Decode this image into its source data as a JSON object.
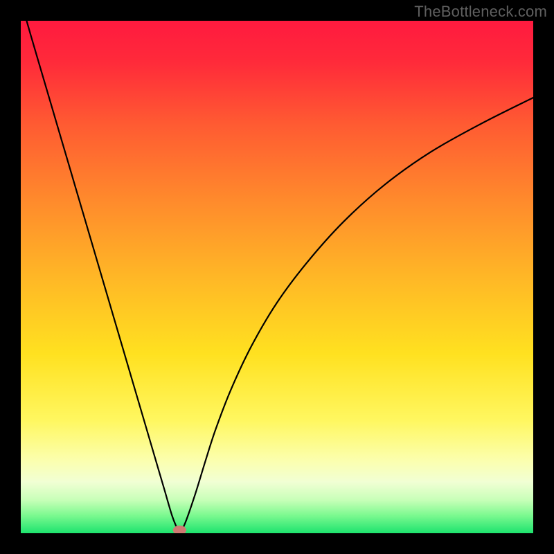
{
  "watermark": {
    "text": "TheBottleneck.com"
  },
  "chart_data": {
    "type": "line",
    "title": "",
    "xlabel": "",
    "ylabel": "",
    "xlim": [
      0,
      100
    ],
    "ylim": [
      0,
      100
    ],
    "gradient_stops": [
      {
        "offset": 0.0,
        "color": "#ff1a3f"
      },
      {
        "offset": 0.08,
        "color": "#ff2a3a"
      },
      {
        "offset": 0.2,
        "color": "#ff5a32"
      },
      {
        "offset": 0.35,
        "color": "#ff8a2c"
      },
      {
        "offset": 0.5,
        "color": "#ffb726"
      },
      {
        "offset": 0.65,
        "color": "#ffe120"
      },
      {
        "offset": 0.78,
        "color": "#fff760"
      },
      {
        "offset": 0.86,
        "color": "#fbffb0"
      },
      {
        "offset": 0.9,
        "color": "#f1ffd4"
      },
      {
        "offset": 0.935,
        "color": "#c8ffb8"
      },
      {
        "offset": 0.965,
        "color": "#7cf990"
      },
      {
        "offset": 1.0,
        "color": "#1de36e"
      }
    ],
    "series": [
      {
        "name": "bottleneck-curve",
        "x": [
          0,
          2,
          4,
          6,
          8,
          10,
          12,
          14,
          16,
          18,
          20,
          22,
          24,
          26,
          28,
          29.5,
          30.5,
          31,
          32,
          34,
          36,
          38,
          41,
          45,
          50,
          56,
          63,
          71,
          80,
          90,
          100
        ],
        "y": [
          104,
          97,
          90.2,
          83.4,
          76.6,
          69.8,
          63.0,
          56.2,
          49.4,
          42.6,
          35.8,
          29.0,
          22.2,
          15.4,
          8.6,
          3.5,
          1.0,
          0.4,
          1.8,
          7.5,
          14.0,
          20.2,
          28.0,
          36.5,
          45.0,
          53.0,
          60.8,
          68.0,
          74.4,
          80.0,
          85.0
        ]
      }
    ],
    "marker": {
      "name": "optimal-point",
      "x": 31.0,
      "y": 0.6,
      "rx": 1.3,
      "ry": 0.9,
      "color": "#cf7a72"
    }
  }
}
